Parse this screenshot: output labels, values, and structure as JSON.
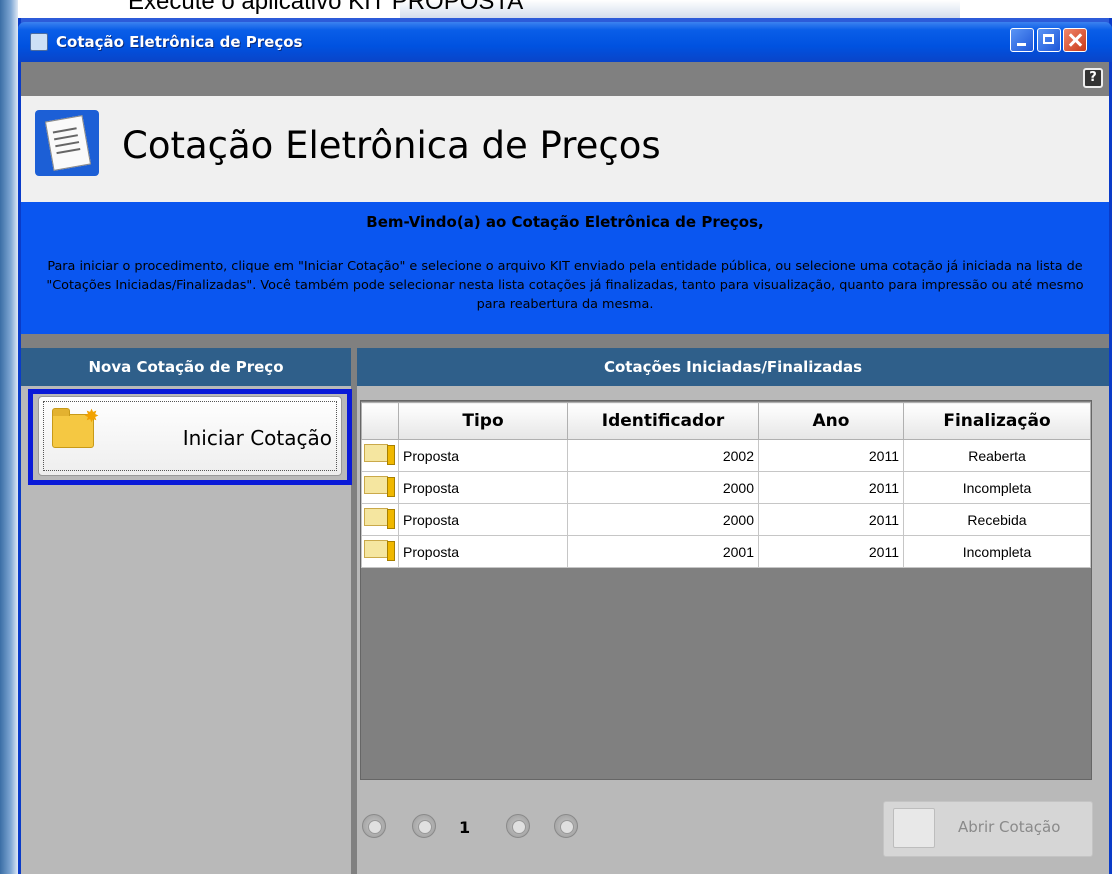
{
  "background": {
    "caption": "Execute o aplicativo KIT PROPOSTA"
  },
  "window": {
    "title": "Cotação Eletrônica de Preços",
    "help_label": "?"
  },
  "header": {
    "title": "Cotação Eletrônica de Preços"
  },
  "banner": {
    "welcome": "Bem-Vindo(a) ao Cotação Eletrônica de Preços,",
    "intro": "Para iniciar o procedimento, clique em \"Iniciar Cotação\" e selecione o arquivo KIT enviado pela entidade pública, ou selecione uma cotação já iniciada na lista de \"Cotações Iniciadas/Finalizadas\". Você também pode selecionar nesta lista cotações já finalizadas, tanto para visualização, quanto para impressão ou até mesmo para reabertura da mesma."
  },
  "left_panel": {
    "heading": "Nova Cotação de Preço",
    "start_button": "Iniciar Cotação"
  },
  "right_panel": {
    "heading": "Cotações Iniciadas/Finalizadas",
    "columns": [
      "Tipo",
      "Identificador",
      "Ano",
      "Finalização"
    ],
    "rows": [
      {
        "tipo": "Proposta",
        "identificador": "2002",
        "ano": "2011",
        "finalizacao": "Reaberta"
      },
      {
        "tipo": "Proposta",
        "identificador": "2000",
        "ano": "2011",
        "finalizacao": "Incompleta"
      },
      {
        "tipo": "Proposta",
        "identificador": "2000",
        "ano": "2011",
        "finalizacao": "Recebida"
      },
      {
        "tipo": "Proposta",
        "identificador": "2001",
        "ano": "2011",
        "finalizacao": "Incompleta"
      }
    ],
    "page": "1",
    "open_button": "Abrir Cotação"
  },
  "colors": {
    "banner": "#0a56f0",
    "panel_header": "#2f5f8a",
    "selection_border": "#0a1ad8"
  },
  "icons": [
    "window-icon",
    "minimize-icon",
    "maximize-icon",
    "close-icon",
    "help-icon",
    "document-icon",
    "new-folder-icon",
    "proposal-row-icon",
    "first-page-icon",
    "previous-page-icon",
    "next-page-icon",
    "last-page-icon",
    "open-folder-icon"
  ]
}
